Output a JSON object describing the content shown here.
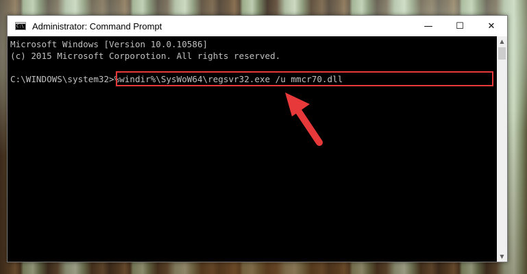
{
  "window": {
    "title": "Administrator: Command Prompt"
  },
  "controls": {
    "minimize": "—",
    "maximize": "☐",
    "close": "✕"
  },
  "console": {
    "lines": [
      "Microsoft Windows [Version 10.0.10586]",
      "(c) 2015 Microsoft Corporotion. All rights reserved.",
      "",
      "C:\\WINDOWS\\system32>%windir%\\SysWoW64\\regsvr32.exe /u mmcr70.dll"
    ]
  },
  "annotation": {
    "highlight_color": "#e8393a",
    "arrow_color": "#e8393a"
  }
}
